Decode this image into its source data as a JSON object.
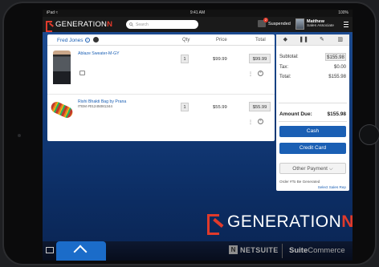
{
  "status_bar": {
    "carrier": "iPad ≈",
    "time": "9:41 AM",
    "battery": "100%"
  },
  "header": {
    "brand": "GENERATION",
    "brand_suffix": "N",
    "search_placeholder": "Search",
    "suspended_label": "Suspended",
    "suspended_count": "2",
    "user_name": "Matthew",
    "user_role": "Sales Associate",
    "colors": {
      "brand_red": "#e03a2b",
      "header_bg": "#1a1a1a"
    }
  },
  "cart": {
    "customer": "Fred Jones",
    "columns": {
      "qty": "Qty",
      "price": "Price",
      "total": "Total"
    },
    "items": [
      {
        "name": "Ablaze Sweater-M-GY",
        "sku": "",
        "qty": "1",
        "price": "$99.99",
        "total": "$99.99"
      },
      {
        "name": "Rishi Bhakti Bag by Prana",
        "sku": "ITEM #01245081344",
        "qty": "1",
        "price": "$55.99",
        "total": "$55.99"
      }
    ]
  },
  "summary": {
    "subtotal_label": "Subtotal:",
    "subtotal": "$155.98",
    "tax_label": "Tax:",
    "tax": "$0.00",
    "total_label": "Total:",
    "total": "$155.98",
    "amount_due_label": "Amount Due:",
    "amount_due": "$155.98",
    "cash_label": "Cash",
    "credit_label": "Credit Card",
    "other_label": "Other Payment",
    "order_note": "Order #To Be Generated",
    "sales_rep_link": "Select Sales Rep",
    "accent": "#1a5fb4"
  },
  "footer": {
    "brand": "GENERATION",
    "brand_suffix": "N",
    "netsuite": "NETSUITE",
    "suitecommerce_a": "Suite",
    "suitecommerce_b": "Commerce"
  }
}
